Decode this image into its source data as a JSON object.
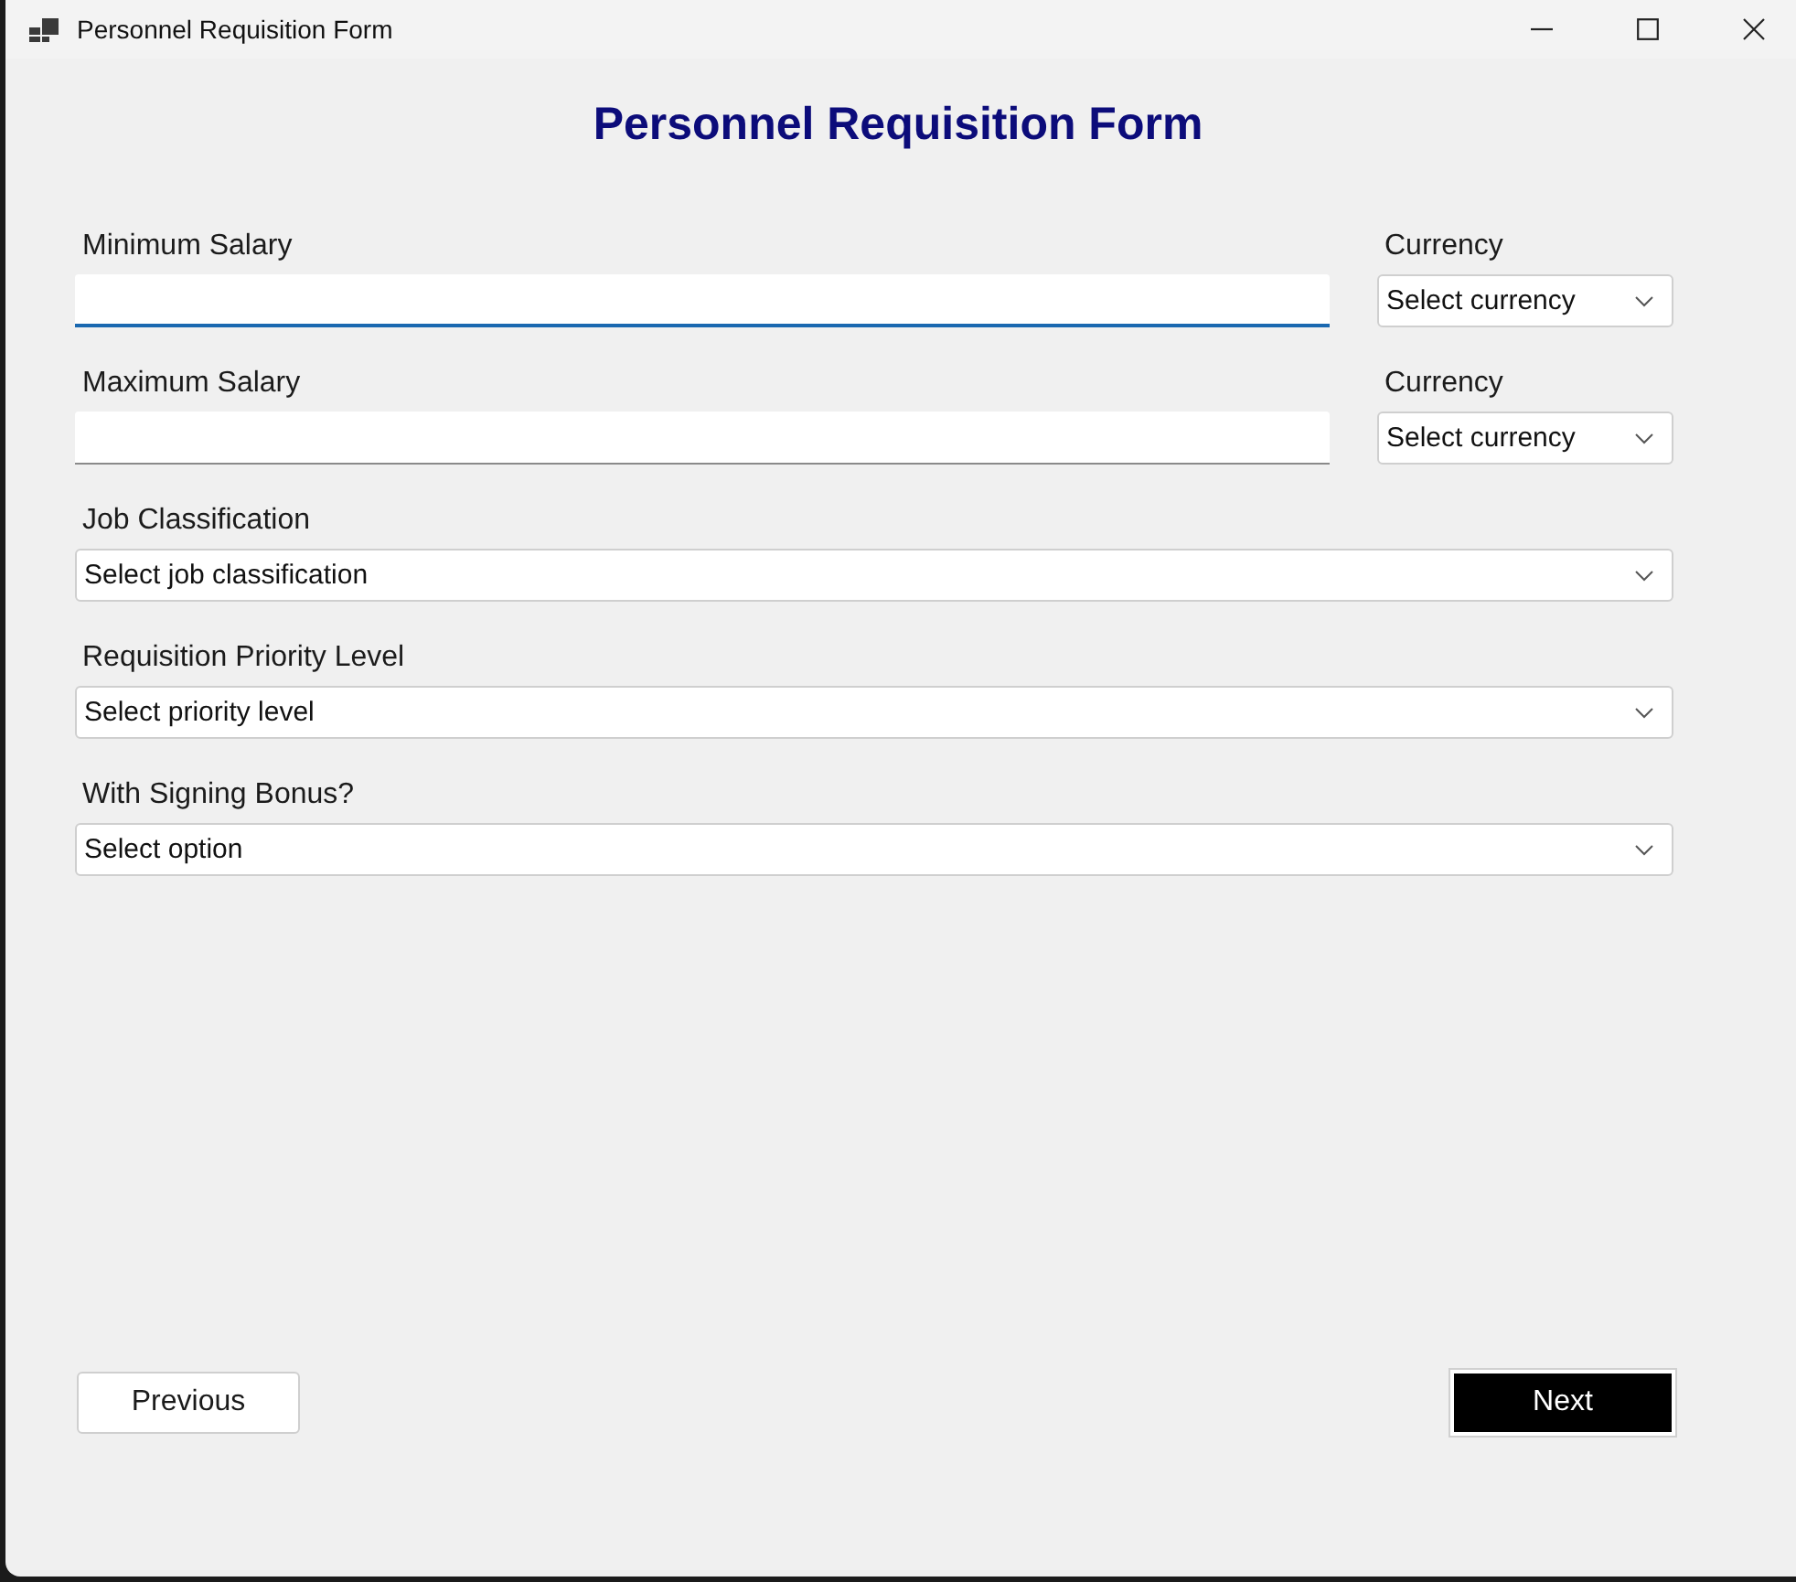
{
  "window": {
    "title": "Personnel Requisition Form"
  },
  "heading": "Personnel Requisition Form",
  "salary_rows": [
    {
      "label": "Minimum Salary",
      "focused": true,
      "currency": {
        "label": "Currency",
        "placeholder": "Select currency"
      }
    },
    {
      "label": "Maximum Salary",
      "focused": false,
      "currency": {
        "label": "Currency",
        "placeholder": "Select currency"
      }
    }
  ],
  "dropdowns": [
    {
      "label": "Job Classification",
      "placeholder": "Select job classification"
    },
    {
      "label": "Requisition Priority Level",
      "placeholder": "Select priority level"
    },
    {
      "label": "With Signing Bonus?",
      "placeholder": "Select option"
    }
  ],
  "buttons": [
    {
      "label": "Previous",
      "kind": "secondary"
    },
    {
      "label": "Next",
      "kind": "primary"
    }
  ]
}
